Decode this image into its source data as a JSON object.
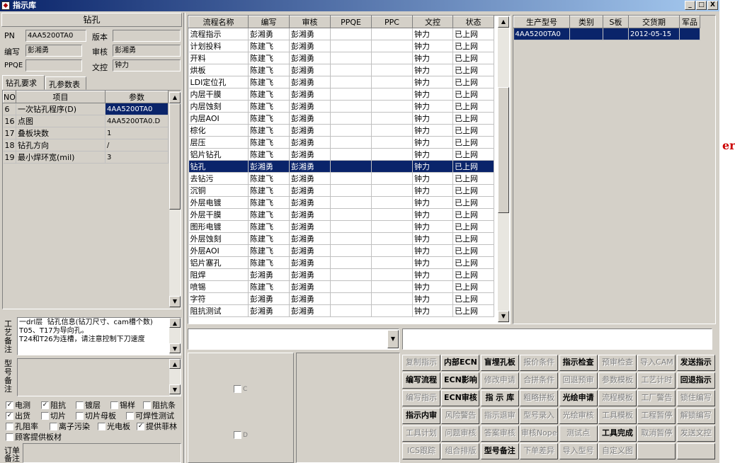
{
  "window": {
    "title": "指示库",
    "min": "_",
    "max": "□",
    "close": "X"
  },
  "left": {
    "header": "钻孔",
    "pn_label": "PN",
    "pn_value": "4AA5200TA0",
    "version_label": "版本",
    "version_value": "",
    "author_label": "编写",
    "author_value": "彭湘勇",
    "review_label": "审核",
    "review_value": "彭湘勇",
    "ppqe_label": "PPQE",
    "ppqe_value": "",
    "dc_label": "文控",
    "dc_value": "钟力",
    "tabs": [
      "钻孔要求",
      "孔参数表"
    ],
    "grid_headers": [
      "NO",
      "项目",
      "参数"
    ],
    "grid_rows": [
      {
        "no": "6",
        "item": "一次钻孔程序(D)",
        "param": "4AA5200TA0"
      },
      {
        "no": "16",
        "item": "点图",
        "param": "4AA5200TA0.D"
      },
      {
        "no": "17",
        "item": "叠板块数",
        "param": "1"
      },
      {
        "no": "18",
        "item": "钻孔方向",
        "param": "/"
      },
      {
        "no": "19",
        "item": "最小焊环宽(mil)",
        "param": "3"
      }
    ],
    "process_note_label": "工艺备注",
    "process_note": "一drl层  钻孔信息(钻刀尺寸、cam槽个数)\nT05、T17为导向孔。\nT24和T26为连槽，请注意控制下刀速度",
    "model_note_label": "型号备注",
    "order_note_label": "订单备注",
    "checks": [
      {
        "label": "电测",
        "checked": true
      },
      {
        "label": "阻抗",
        "checked": true
      },
      {
        "label": "镀层",
        "checked": false
      },
      {
        "label": "锡样",
        "checked": false
      },
      {
        "label": "阻抗条",
        "checked": false
      },
      {
        "label": "出货",
        "checked": true
      },
      {
        "label": "切片",
        "checked": false
      },
      {
        "label": "切片母板",
        "checked": false
      },
      {
        "label": "可焊性测试",
        "checked": false
      },
      {
        "label": "孔阻率",
        "checked": false
      },
      {
        "label": "离子污染",
        "checked": false
      },
      {
        "label": "光电板",
        "checked": false
      },
      {
        "label": "提供菲林",
        "checked": true
      },
      {
        "label": "顾客提供板材",
        "checked": false
      }
    ]
  },
  "process_grid": {
    "headers": [
      "流程名称",
      "编写",
      "审核",
      "PPQE",
      "PPC",
      "文控",
      "状态"
    ],
    "rows": [
      [
        "流程指示",
        "彭湘勇",
        "彭湘勇",
        "",
        "",
        "钟力",
        "已上网"
      ],
      [
        "计划投料",
        "陈建飞",
        "彭湘勇",
        "",
        "",
        "钟力",
        "已上网"
      ],
      [
        "开料",
        "陈建飞",
        "彭湘勇",
        "",
        "",
        "钟力",
        "已上网"
      ],
      [
        "烘板",
        "陈建飞",
        "彭湘勇",
        "",
        "",
        "钟力",
        "已上网"
      ],
      [
        "LDI定位孔",
        "陈建飞",
        "彭湘勇",
        "",
        "",
        "钟力",
        "已上网"
      ],
      [
        "内层干膜",
        "陈建飞",
        "彭湘勇",
        "",
        "",
        "钟力",
        "已上网"
      ],
      [
        "内层蚀刻",
        "陈建飞",
        "彭湘勇",
        "",
        "",
        "钟力",
        "已上网"
      ],
      [
        "内层AOI",
        "陈建飞",
        "彭湘勇",
        "",
        "",
        "钟力",
        "已上网"
      ],
      [
        "棕化",
        "陈建飞",
        "彭湘勇",
        "",
        "",
        "钟力",
        "已上网"
      ],
      [
        "层压",
        "陈建飞",
        "彭湘勇",
        "",
        "",
        "钟力",
        "已上网"
      ],
      [
        "铝片钻孔",
        "陈建飞",
        "彭湘勇",
        "",
        "",
        "钟力",
        "已上网"
      ],
      [
        "钻孔",
        "彭湘勇",
        "彭湘勇",
        "",
        "",
        "钟力",
        "已上网"
      ],
      [
        "去钻污",
        "陈建飞",
        "彭湘勇",
        "",
        "",
        "钟力",
        "已上网"
      ],
      [
        "沉铜",
        "陈建飞",
        "彭湘勇",
        "",
        "",
        "钟力",
        "已上网"
      ],
      [
        "外层电镀",
        "陈建飞",
        "彭湘勇",
        "",
        "",
        "钟力",
        "已上网"
      ],
      [
        "外层干膜",
        "陈建飞",
        "彭湘勇",
        "",
        "",
        "钟力",
        "已上网"
      ],
      [
        "图形电镀",
        "陈建飞",
        "彭湘勇",
        "",
        "",
        "钟力",
        "已上网"
      ],
      [
        "外层蚀刻",
        "陈建飞",
        "彭湘勇",
        "",
        "",
        "钟力",
        "已上网"
      ],
      [
        "外层AOI",
        "陈建飞",
        "彭湘勇",
        "",
        "",
        "钟力",
        "已上网"
      ],
      [
        "铝片塞孔",
        "陈建飞",
        "彭湘勇",
        "",
        "",
        "钟力",
        "已上网"
      ],
      [
        "阻焊",
        "彭湘勇",
        "彭湘勇",
        "",
        "",
        "钟力",
        "已上网"
      ],
      [
        "喷锡",
        "陈建飞",
        "彭湘勇",
        "",
        "",
        "钟力",
        "已上网"
      ],
      [
        "字符",
        "彭湘勇",
        "彭湘勇",
        "",
        "",
        "钟力",
        "已上网"
      ],
      [
        "阻抗测试",
        "彭湘勇",
        "彭湘勇",
        "",
        "",
        "钟力",
        "已上网"
      ]
    ],
    "selected_index": 11
  },
  "model_grid": {
    "headers": [
      "生产型号",
      "类别",
      "S板",
      "交货期",
      "军品"
    ],
    "rows": [
      [
        "4AA5200TA0",
        "",
        "",
        "2012-05-15",
        ""
      ]
    ]
  },
  "mid_checks": {
    "c": "C",
    "d": "D"
  },
  "buttons": [
    {
      "label": "复制指示",
      "enabled": false
    },
    {
      "label": "内部ECN",
      "enabled": true
    },
    {
      "label": "盲埋孔板",
      "enabled": true
    },
    {
      "label": "报价条件",
      "enabled": false
    },
    {
      "label": "指示检查",
      "enabled": true
    },
    {
      "label": "预审检查",
      "enabled": false
    },
    {
      "label": "导入CAM",
      "enabled": false
    },
    {
      "label": "发送指示",
      "enabled": true
    },
    {
      "label": "编写流程",
      "enabled": true
    },
    {
      "label": "ECN影响",
      "enabled": true
    },
    {
      "label": "修改申请",
      "enabled": false
    },
    {
      "label": "合拼条件",
      "enabled": false
    },
    {
      "label": "回退预审",
      "enabled": false
    },
    {
      "label": "参数模板",
      "enabled": false
    },
    {
      "label": "工艺计时",
      "enabled": false
    },
    {
      "label": "回退指示",
      "enabled": true
    },
    {
      "label": "编写指示",
      "enabled": false
    },
    {
      "label": "ECN审核",
      "enabled": true
    },
    {
      "label": "指 示 库",
      "enabled": true
    },
    {
      "label": "粗略拼板",
      "enabled": false
    },
    {
      "label": "光绘申请",
      "enabled": true
    },
    {
      "label": "流程模板",
      "enabled": false
    },
    {
      "label": "工厂警告",
      "enabled": false
    },
    {
      "label": "锁住编写",
      "enabled": false
    },
    {
      "label": "指示内审",
      "enabled": true
    },
    {
      "label": "风险警告",
      "enabled": false
    },
    {
      "label": "指示退审",
      "enabled": false
    },
    {
      "label": "型号录入",
      "enabled": false
    },
    {
      "label": "光绘审核",
      "enabled": false
    },
    {
      "label": "工具模板",
      "enabled": false
    },
    {
      "label": "工程暂停",
      "enabled": false
    },
    {
      "label": "解锁编写",
      "enabled": false
    },
    {
      "label": "工具计划",
      "enabled": false
    },
    {
      "label": "问题审核",
      "enabled": false
    },
    {
      "label": "答案审核",
      "enabled": false
    },
    {
      "label": "审核Nope",
      "enabled": false
    },
    {
      "label": "测试点",
      "enabled": false
    },
    {
      "label": "工具完成",
      "enabled": true
    },
    {
      "label": "取消暂停",
      "enabled": false
    },
    {
      "label": "发送文控",
      "enabled": false
    },
    {
      "label": "ICS跟踪",
      "enabled": false
    },
    {
      "label": "组合排版",
      "enabled": false
    },
    {
      "label": "型号备注",
      "enabled": true
    },
    {
      "label": "下单差异",
      "enabled": false
    },
    {
      "label": "导入型号",
      "enabled": false
    },
    {
      "label": "自定义图",
      "enabled": false
    },
    {
      "label": "",
      "enabled": false
    },
    {
      "label": "",
      "enabled": false
    }
  ],
  "colors": {
    "selection": "#0a246a",
    "face": "#d4d0c8",
    "title_start": "#0a246a",
    "title_end": "#a6caf0",
    "accent_red": "#cc0000"
  },
  "background_text": "er"
}
